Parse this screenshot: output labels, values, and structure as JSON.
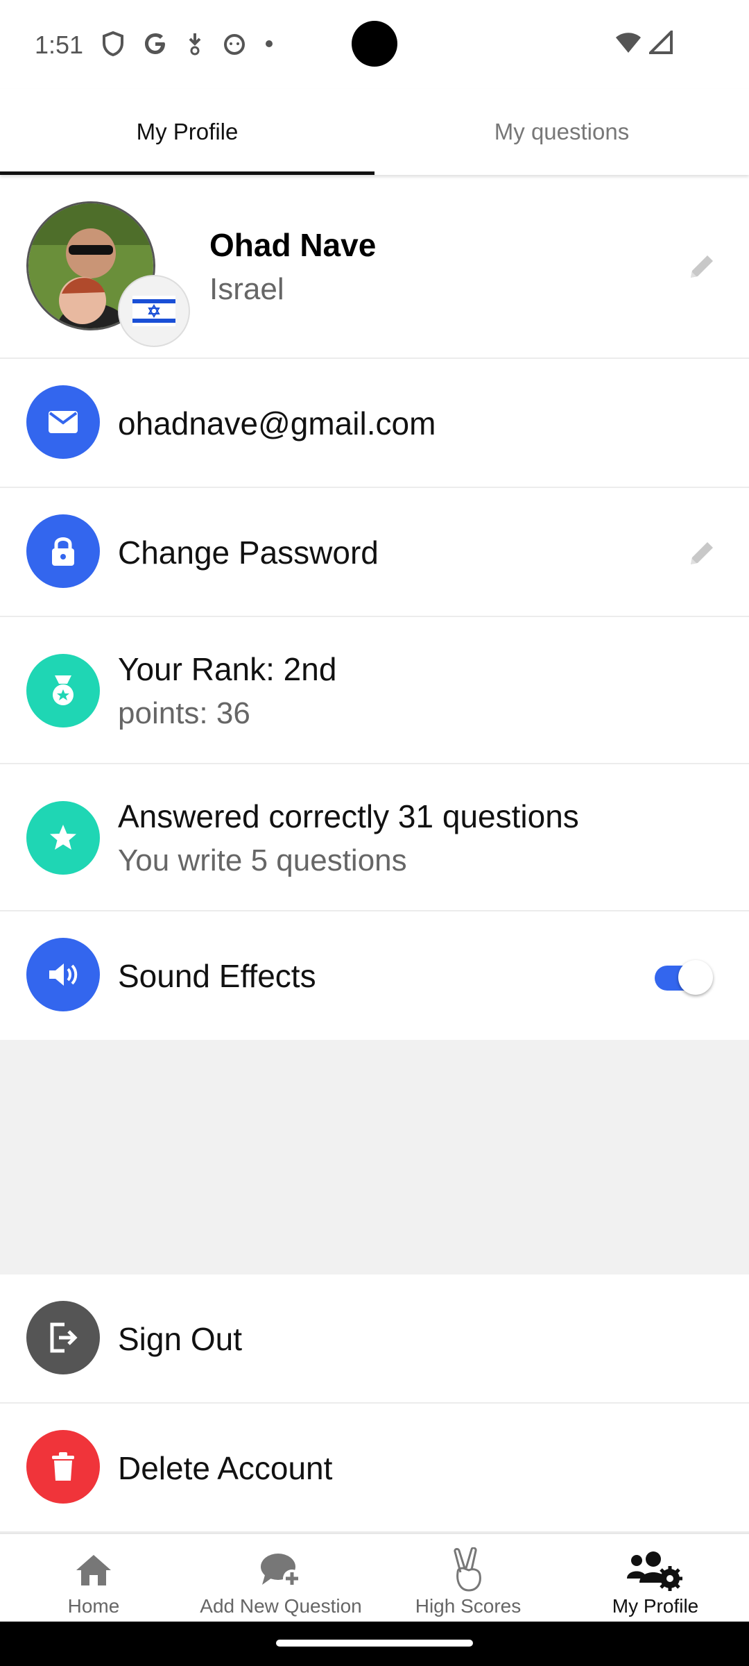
{
  "status_bar": {
    "time": "1:51"
  },
  "tabs": [
    {
      "label": "My Profile",
      "active": true
    },
    {
      "label": "My questions",
      "active": false
    }
  ],
  "profile": {
    "name": "Ohad Nave",
    "country": "Israel"
  },
  "email": {
    "value": "ohadnave@gmail.com"
  },
  "password": {
    "label": "Change Password"
  },
  "rank": {
    "title": "Your Rank: 2nd",
    "points": "points: 36"
  },
  "stats": {
    "answered": "Answered correctly 31 questions",
    "written": "You write 5 questions"
  },
  "sound": {
    "label": "Sound Effects",
    "enabled": true
  },
  "sign_out": {
    "label": "Sign Out"
  },
  "delete_account": {
    "label": "Delete Account"
  },
  "bottom_nav": [
    {
      "label": "Home",
      "icon": "home-icon"
    },
    {
      "label": "Add New Question",
      "icon": "add-comment-icon"
    },
    {
      "label": "High Scores",
      "icon": "victory-hand-icon"
    },
    {
      "label": "My Profile",
      "icon": "users-gear-icon",
      "active": true
    }
  ],
  "colors": {
    "primary_blue": "#3366ee",
    "teal": "#1fd6b4",
    "sign_out_gray": "#555555",
    "delete_red": "#f0343a"
  }
}
